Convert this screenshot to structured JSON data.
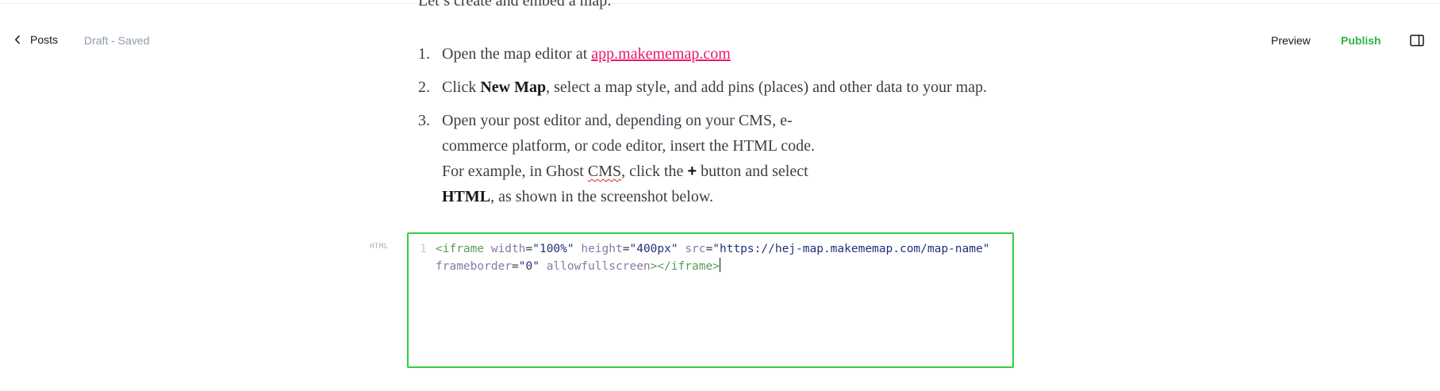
{
  "header": {
    "back_label": "Posts",
    "status": "Draft - Saved",
    "preview_label": "Preview",
    "publish_label": "Publish",
    "icons": {
      "back": "chevron-left-icon",
      "sidebar": "sidebar-toggle-icon"
    },
    "colors": {
      "publish": "#2fb344"
    }
  },
  "content": {
    "cut_line": "Let’s create and embed a map:",
    "steps": [
      {
        "num": "1.",
        "text_before": "Open the map editor at ",
        "link": "app.makememap.com"
      },
      {
        "num": "2.",
        "text_before": "Click ",
        "bold": "New Map",
        "text_after": ", select a map style, and add pins (places) and other data to your map."
      },
      {
        "num": "3.",
        "line1": "Open your post editor and, depending on your CMS, e-commerce platform, or code editor, insert the HTML code.",
        "line2_before": "For example, in Ghost ",
        "line2_misspelled": "CMS",
        "line2_mid": ", click the ",
        "line2_plus": "+",
        "line2_mid2": " button and select ",
        "line2_bold": "HTML",
        "line2_after": ", as shown in the screenshot below."
      }
    ]
  },
  "html_card": {
    "label": "HTML",
    "line_number": "1",
    "tokens": {
      "open_tag": "<iframe",
      "attr_width": "width",
      "val_width": "\"100%\"",
      "attr_height": "height",
      "val_height": "\"400px\"",
      "attr_src": "src",
      "val_src": "\"https://hej-map.makememap.com/map-name\"",
      "attr_frameborder": "frameborder",
      "val_frameborder": "\"0\"",
      "attr_allow": "allowfullscreen",
      "close_tag": "></iframe>"
    },
    "colors": {
      "border": "#30cf43"
    }
  }
}
